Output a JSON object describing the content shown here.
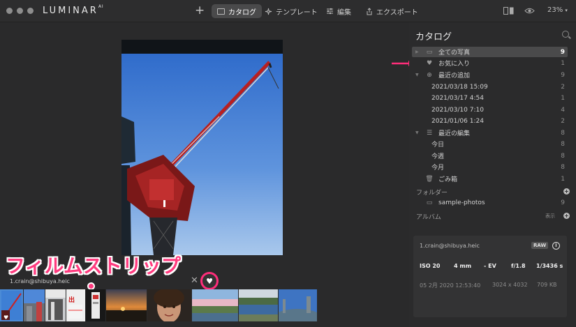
{
  "app": {
    "logo": "LUMINAR",
    "logo_sup": "AI"
  },
  "toolbar": {
    "add_label": "+",
    "tabs": [
      {
        "label": "カタログ",
        "active": true,
        "icon": "folder-icon"
      },
      {
        "label": "テンプレート",
        "active": false,
        "icon": "sparkle-icon"
      },
      {
        "label": "編集",
        "active": false,
        "icon": "sliders-icon"
      },
      {
        "label": "エクスポート",
        "active": false,
        "icon": "share-icon"
      }
    ],
    "zoom": "23%"
  },
  "sidebar": {
    "title": "カタログ",
    "items": [
      {
        "label": "全ての写真",
        "count": "9",
        "icon": "photos-icon",
        "selected": true
      },
      {
        "label": "お気に入り",
        "count": "1",
        "icon": "heart-icon"
      },
      {
        "label": "最近の追加",
        "count": "9",
        "icon": "plus-circle-icon"
      },
      {
        "label": "2021/03/18 15:09",
        "count": "2"
      },
      {
        "label": "2021/03/17 4:54",
        "count": "1"
      },
      {
        "label": "2021/03/10 7:10",
        "count": "4"
      },
      {
        "label": "2021/01/06 1:24",
        "count": "2"
      },
      {
        "label": "最近の編集",
        "count": "8",
        "icon": "sliders-icon"
      },
      {
        "label": "今日",
        "count": "8"
      },
      {
        "label": "今週",
        "count": "8"
      },
      {
        "label": "今月",
        "count": "8"
      },
      {
        "label": "ごみ箱",
        "count": "1",
        "icon": "trash-icon"
      }
    ],
    "folders_label": "フォルダー",
    "folder": {
      "label": "sample-photos",
      "count": "9"
    },
    "albums_label": "アルバム",
    "albums_show": "表示"
  },
  "info": {
    "filename": "1.crain@shibuya.heic",
    "raw": "RAW",
    "iso": "ISO 20",
    "focal": "4 mm",
    "ev": "- EV",
    "aperture": "f/1.8",
    "shutter": "1/3436 s",
    "date": "05 2月 2020 12:53:40",
    "dims": "3024 x 4032",
    "size": "709 KB"
  },
  "viewer": {
    "filename": "1.crain@shibuya.heic"
  },
  "annotation": {
    "filmstrip_label": "フィルムストリップ"
  },
  "colors": {
    "accent_pink": "#ff2d7a",
    "selection_blue": "#4b8bd6"
  }
}
